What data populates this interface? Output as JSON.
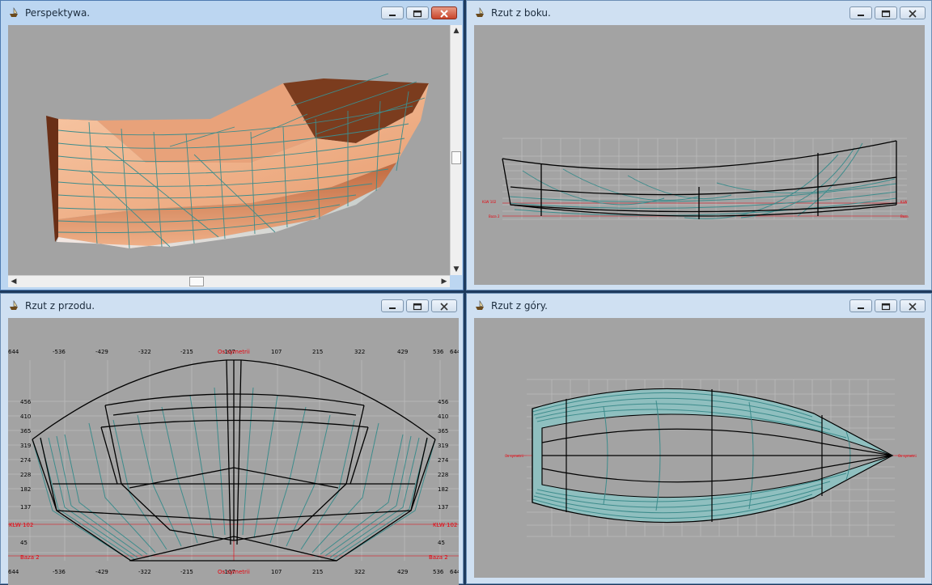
{
  "windows": {
    "perspective": {
      "title": "Perspektywa."
    },
    "side": {
      "title": "Rzut z boku."
    },
    "front": {
      "title": "Rzut z przodu."
    },
    "top": {
      "title": "Rzut z góry."
    }
  },
  "front_view": {
    "top_ticks": [
      "644",
      "-536",
      "-429",
      "-322",
      "-215",
      "-107",
      "Os symetrii",
      "107",
      "215",
      "322",
      "429",
      "536",
      "644"
    ],
    "bottom_ticks": [
      "644",
      "-536",
      "-429",
      "-322",
      "-215",
      "-107",
      "Os symetrii",
      "107",
      "215",
      "322",
      "429",
      "536",
      "644"
    ],
    "left_ticks": [
      "456",
      "410",
      "365",
      "319",
      "274",
      "228",
      "182",
      "137",
      "KLW 102",
      "45",
      "Baza 2"
    ],
    "right_ticks": [
      "456",
      "410",
      "365",
      "319",
      "274",
      "228",
      "182",
      "137",
      "KLW 102",
      "45",
      "Baza 2"
    ]
  },
  "colors": {
    "hull_light": "#f6c09a",
    "hull_mid": "#d9875d",
    "hull_dark": "#7a3a1e",
    "mesh": "#3d8c8c",
    "outline": "#000000",
    "label_red": "#e8000c",
    "background": "#a3a3a3",
    "close_red": "#c9452b"
  },
  "icons": {
    "app": "boat-app-icon",
    "minimize": "minimize-icon",
    "maximize": "maximize-icon",
    "close": "close-icon"
  }
}
